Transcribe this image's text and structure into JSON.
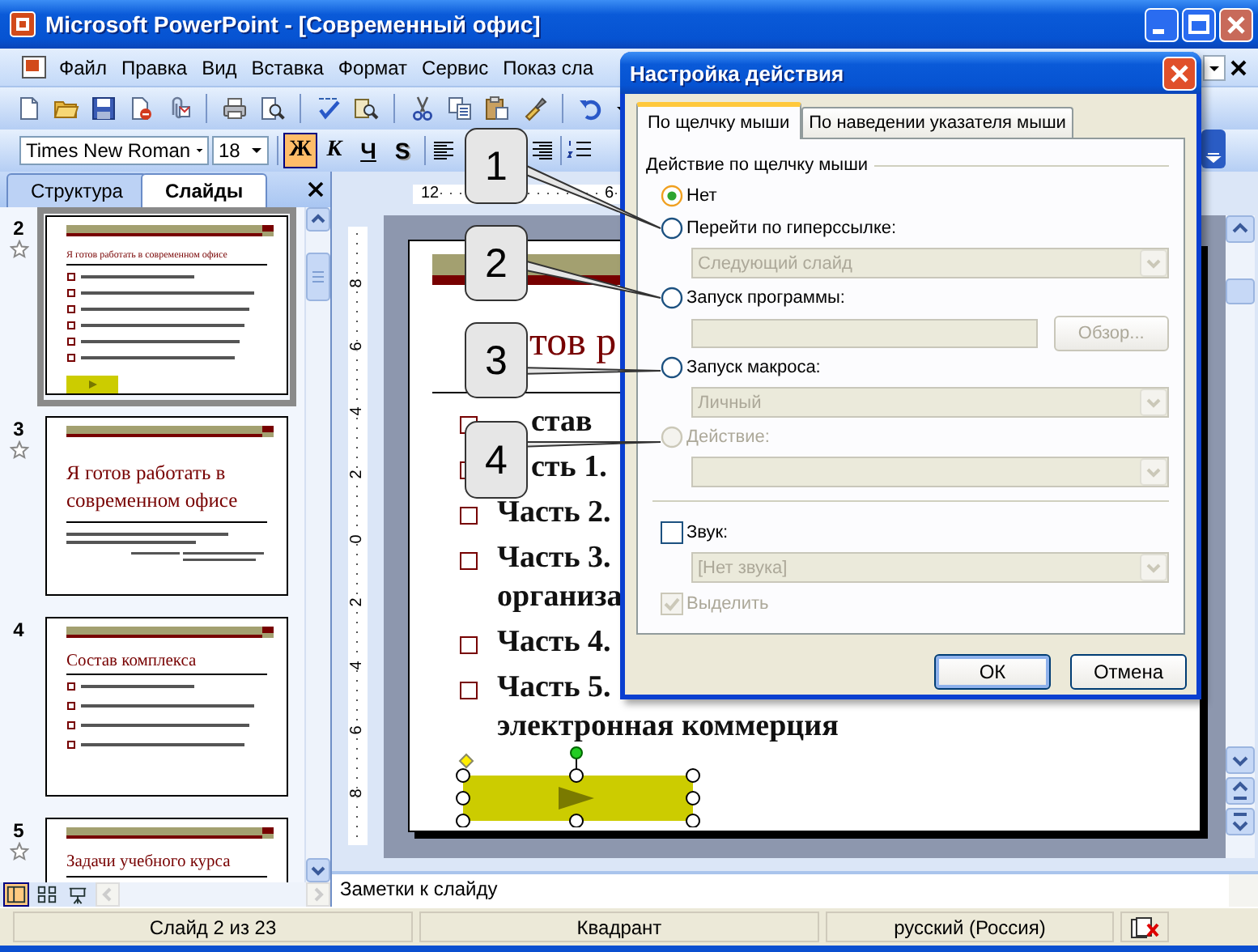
{
  "window": {
    "title": "Microsoft PowerPoint - [Современный офис]"
  },
  "menu": [
    "Файл",
    "Правка",
    "Вид",
    "Вставка",
    "Формат",
    "Сервис",
    "Показ сла"
  ],
  "formatting": {
    "font": "Times New Roman",
    "size": "18",
    "styles": [
      {
        "label": "Ж",
        "kind": "bold",
        "on": true
      },
      {
        "label": "К",
        "kind": "italic",
        "on": false
      },
      {
        "label": "Ч",
        "kind": "underline",
        "on": false
      },
      {
        "label": "S",
        "kind": "shadow",
        "on": false
      }
    ]
  },
  "pane_tabs": [
    {
      "label": "Структура",
      "selected": false
    },
    {
      "label": "Слайды",
      "selected": true
    }
  ],
  "thumbnails": [
    {
      "number": "2",
      "selected": true,
      "transition": true,
      "kind": "bullets_button",
      "title": "Я готов работать в современном офисе"
    },
    {
      "number": "3",
      "selected": false,
      "transition": true,
      "kind": "title_slide",
      "title": "Я готов работать в современном офисе"
    },
    {
      "number": "4",
      "selected": false,
      "transition": false,
      "kind": "bullets",
      "title": "Состав комплекса"
    },
    {
      "number": "5",
      "selected": false,
      "transition": true,
      "kind": "heading",
      "title": "Задачи учебного курса"
    }
  ],
  "view_buttons": [
    {
      "kind": "normal",
      "selected": true
    },
    {
      "kind": "sorter",
      "selected": false
    },
    {
      "kind": "show",
      "selected": false
    }
  ],
  "rulers": {
    "horizontal": [
      "12",
      "6"
    ],
    "vertical": [
      "8",
      "6",
      "4",
      "2",
      "0",
      "2",
      "4",
      "6",
      "8"
    ]
  },
  "slide": {
    "title": "тов р",
    "bullets": [
      {
        "lines": [
          "став"
        ],
        "covered": true
      },
      {
        "lines": [
          "сть 1."
        ],
        "covered": true
      },
      {
        "lines": [
          "Часть 2."
        ],
        "covered": false
      },
      {
        "lines": [
          "Часть 3.",
          "организа"
        ],
        "covered": false
      },
      {
        "lines": [
          "Часть 4."
        ],
        "covered": false
      },
      {
        "lines": [
          "Часть 5.",
          "электронная коммерция"
        ],
        "covered": false
      }
    ]
  },
  "notes": {
    "text": "Заметки к слайду"
  },
  "status_bar": [
    "Слайд 2 из 23",
    "Квадрант",
    "русский (Россия)"
  ],
  "dialog": {
    "title": "Настройка действия",
    "tabs": [
      {
        "label": "По щелчку мыши",
        "selected": true
      },
      {
        "label": "По наведении указателя мыши",
        "selected": false
      }
    ],
    "group": "Действие по щелчку мыши",
    "rows": [
      {
        "kind": "radio",
        "label": "Нет",
        "selected": true,
        "disabled": false
      },
      {
        "kind": "radio",
        "label": "Перейти по гиперссылке:",
        "selected": false,
        "disabled": false
      },
      {
        "kind": "dropdown",
        "value": "Следующий слайд",
        "disabled": true
      },
      {
        "kind": "radio",
        "label": "Запуск программы:",
        "selected": false,
        "disabled": false
      },
      {
        "kind": "field_browse",
        "button": "Обзор...",
        "disabled": true
      },
      {
        "kind": "radio",
        "label": "Запуск макроса:",
        "selected": false,
        "disabled": false
      },
      {
        "kind": "dropdown",
        "value": "Личный",
        "disabled": true
      },
      {
        "kind": "radio",
        "label": "Действие:",
        "selected": false,
        "disabled": true
      },
      {
        "kind": "dropdown",
        "disabled": true
      },
      {
        "kind": "separator"
      },
      {
        "kind": "checkbox",
        "label": "Звук:",
        "checked": false,
        "disabled": false
      },
      {
        "kind": "dropdown",
        "value": "[Нет звука]",
        "disabled": true
      },
      {
        "kind": "checkbox",
        "label": "Выделить",
        "checked": true,
        "disabled": true
      }
    ],
    "buttons": [
      {
        "label": "ОК",
        "default": true
      },
      {
        "label": "Отмена",
        "default": false
      }
    ]
  },
  "callouts": [
    "1",
    "2",
    "3",
    "4"
  ]
}
